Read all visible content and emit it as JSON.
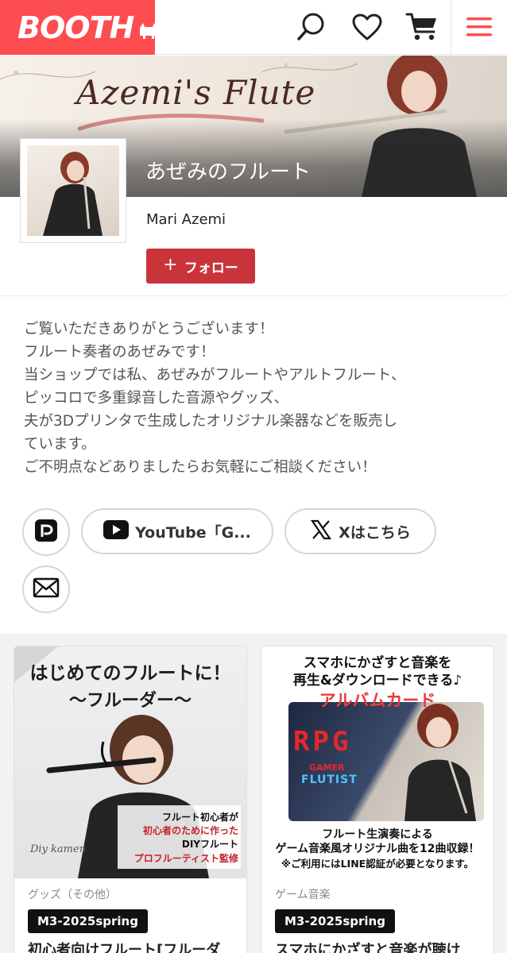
{
  "header": {
    "logo": "BOOTH",
    "brand_color": "#fc4d50"
  },
  "banner": {
    "script_text": "Azemi's Flute"
  },
  "shop": {
    "title": "あぜみのフルート",
    "owner": "Mari Azemi",
    "follow_label": "フォロー"
  },
  "description": [
    "ご覧いただきありがとうございます！",
    "フルート奏者のあぜみです！",
    "当ショップでは私、あぜみがフルートやアルトフルート、",
    "ピッコロで多重録音した音源やグッズ、",
    "夫が3Dプリンタで生成したオリジナル楽器などを販売し",
    "ています。",
    "ご不明点などありましたらお気軽にご相談ください！"
  ],
  "links": {
    "youtube": "YouTube「G...",
    "x": "Xはこちら"
  },
  "items": [
    {
      "category": "グッズ（その他）",
      "event": "M3-2025spring",
      "title": "初心者向けフルート[フルーダ",
      "image_text": {
        "h1": "はじめてのフルートに！",
        "h2": "〜フルーダー〜",
        "t1": "フルート初心者が",
        "t2": "初心者のために作った",
        "t3": "DIYフルート",
        "t4": "プロフルーティスト監修",
        "sig": "Diy kamen"
      }
    },
    {
      "category": "ゲーム音楽",
      "event": "M3-2025spring",
      "title": "スマホにかざすと音楽が聴け",
      "image_text": {
        "h1": "スマホにかざすと音楽を",
        "h2": "再生&ダウンロードできる♪",
        "h3": "アルバムカード",
        "rpg": "RPG",
        "gamer": "GAMER",
        "flutist": "FLUTIST",
        "f1": "フルート生演奏による",
        "f2": "ゲーム音楽風オリジナル曲を12曲収録！",
        "f3": "※ご利用にはLINE認証が必要となります。"
      }
    }
  ]
}
